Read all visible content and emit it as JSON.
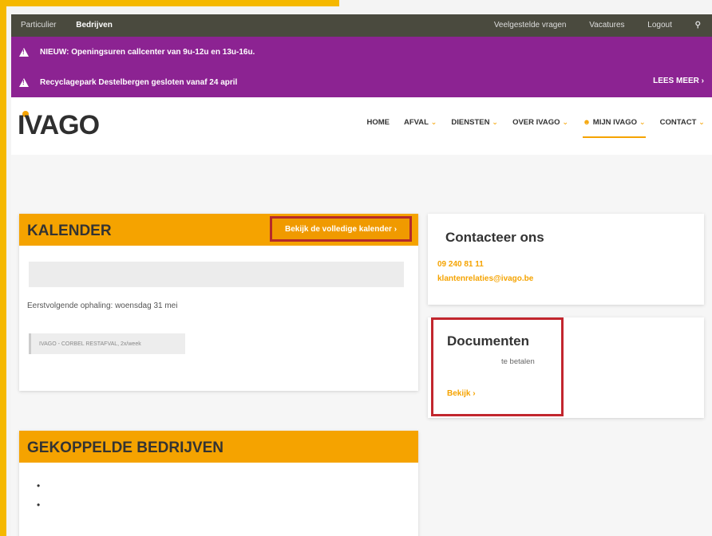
{
  "topbar": {
    "left": [
      "Particulier",
      "Bedrijven"
    ],
    "right": [
      "Veelgestelde vragen",
      "Vacatures",
      "Logout"
    ],
    "search_icon": "search-icon"
  },
  "alerts": [
    {
      "text": "NIEUW: Openingsuren callcenter van 9u-12u en 13u-16u."
    },
    {
      "text": "Recyclagepark Destelbergen gesloten vanaf 24 april"
    }
  ],
  "lees_meer": "LEES MEER ›",
  "header": {
    "logo": "IVAGO",
    "nav": [
      {
        "label": "HOME",
        "chev": false
      },
      {
        "label": "AFVAL",
        "chev": true
      },
      {
        "label": "DIENSTEN",
        "chev": true
      },
      {
        "label": "OVER IVAGO",
        "chev": true
      },
      {
        "label": "MIJN IVAGO",
        "chev": true,
        "active": true
      },
      {
        "label": "CONTACT",
        "chev": true
      }
    ]
  },
  "kalender": {
    "title": "KALENDER",
    "link": "Bekijk de volledige kalender ›",
    "next_pickup": "Eerstvolgende ophaling: woensdag 31 mei",
    "address": "IVAGO - CORBEL RESTAFVAL, 2x/week"
  },
  "contact": {
    "title": "Contacteer ons",
    "phone": "09 240 81 11",
    "email": "klantenrelaties@ivago.be"
  },
  "documenten": {
    "title": "Documenten",
    "sub": "te betalen",
    "link": "Bekijk ›"
  },
  "gekoppelde": {
    "title": "GEKOPPELDE BEDRIJVEN",
    "bullets": [
      "•",
      "•"
    ]
  },
  "colors": {
    "accent": "#f5a300",
    "purple": "#8c2392",
    "topbar": "#4a4a3e",
    "highlight": "#c2262e"
  }
}
